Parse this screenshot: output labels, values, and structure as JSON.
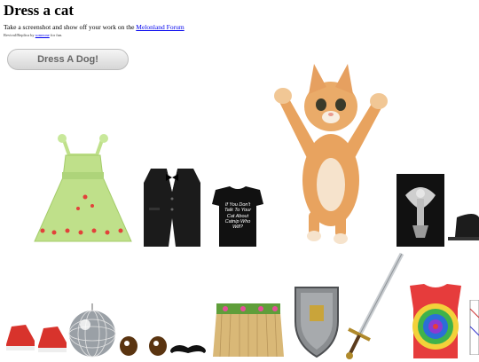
{
  "page": {
    "title": "Dress a cat",
    "intro_prefix": "Take a screenshot and show off your work on the ",
    "intro_link": "Melonland Forum",
    "credit_prefix": "Revival/Replica by ",
    "credit_link": "someone",
    "credit_suffix": " for fun."
  },
  "buttons": {
    "dress_dog": "Dress A Dog!"
  },
  "items": {
    "tshirt_text": "If You Don't Talk To Your Cat About Catnip Who Will?"
  },
  "colors": {
    "dress_green": "#bfe08a",
    "vest_black": "#1b1b1b",
    "cat_orange": "#e8a35f",
    "button_gray": "#d6d6d6",
    "link_blue": "#0000ee"
  }
}
